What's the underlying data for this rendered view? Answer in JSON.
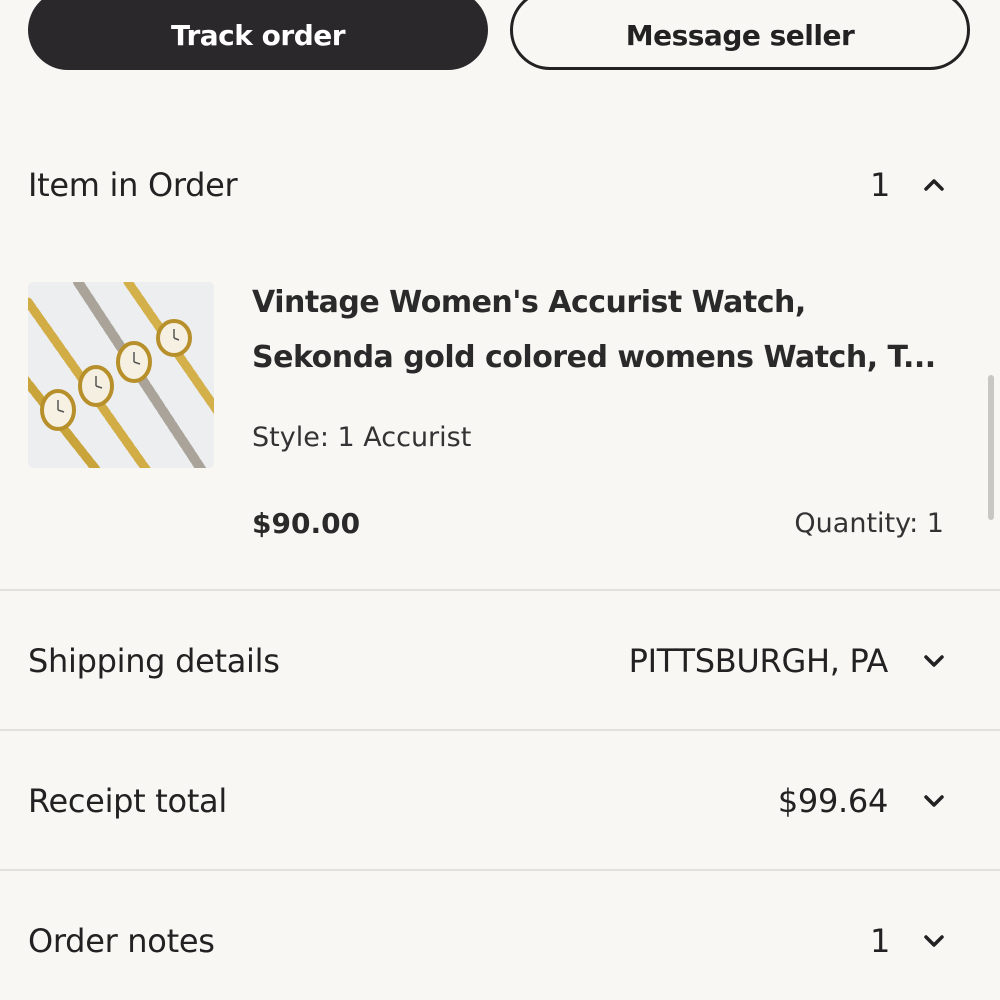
{
  "actions": {
    "track_order": "Track order",
    "message_seller": "Message seller"
  },
  "items_section": {
    "label": "Item in Order",
    "count": "1",
    "toggle_icon": "chevron-up-icon"
  },
  "item": {
    "title_line1": "Vintage Women's Accurist Watch,",
    "title_line2": "Sekonda gold colored womens Watch, T...",
    "style": "Style: 1 Accurist",
    "price": "$90.00",
    "quantity": "Quantity: 1",
    "image_icon": "watch-photo"
  },
  "shipping": {
    "label": "Shipping details",
    "value": "PITTSBURGH, PA",
    "toggle_icon": "chevron-down-icon"
  },
  "receipt": {
    "label": "Receipt total",
    "value": "$99.64",
    "toggle_icon": "chevron-down-icon"
  },
  "notes": {
    "label": "Order notes",
    "value": "1",
    "toggle_icon": "chevron-down-icon"
  },
  "colors": {
    "background": "#f8f7f4",
    "primary_button": "#2b282c",
    "divider": "#e3e1dd"
  }
}
